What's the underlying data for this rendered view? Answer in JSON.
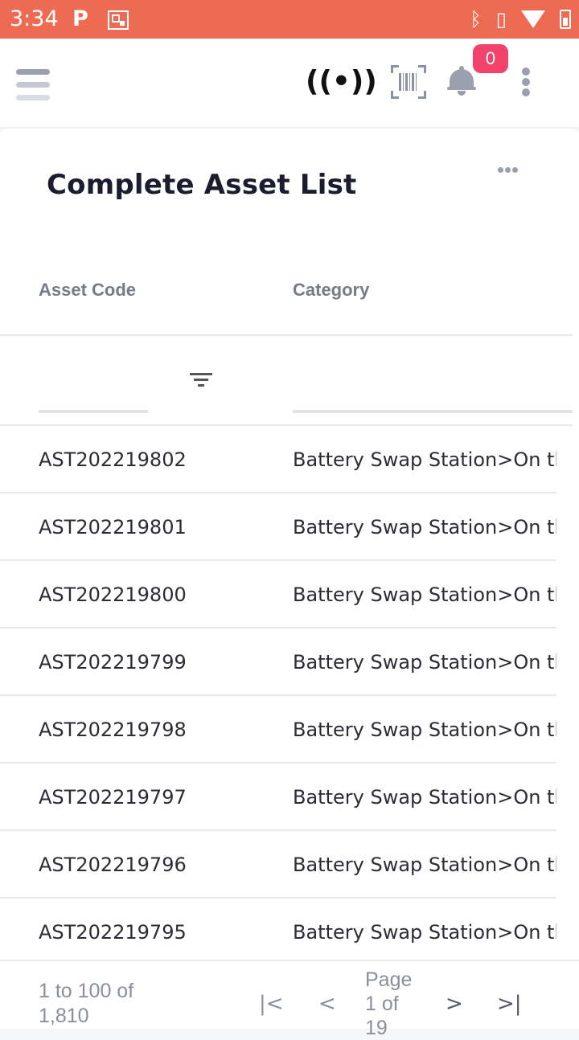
{
  "status_bar": {
    "time": "3:34",
    "notification_icons": [
      "p-icon",
      "qr-icon"
    ],
    "system_icons": [
      "bluetooth-icon",
      "vibrate-icon",
      "wifi-icon",
      "battery-icon"
    ]
  },
  "app_bar": {
    "icons": [
      "menu-icon",
      "rfid-icon",
      "barcode-scan-icon",
      "bell-icon",
      "more-vertical-icon"
    ],
    "rfid_glyph": "((•))",
    "notification_count": "0"
  },
  "card": {
    "title": "Complete Asset List"
  },
  "table": {
    "columns": [
      "Asset Code",
      "Category"
    ],
    "rows": [
      {
        "code": "AST202219802",
        "category": "Battery Swap Station>On the"
      },
      {
        "code": "AST202219801",
        "category": "Battery Swap Station>On the"
      },
      {
        "code": "AST202219800",
        "category": "Battery Swap Station>On the"
      },
      {
        "code": "AST202219799",
        "category": "Battery Swap Station>On the"
      },
      {
        "code": "AST202219798",
        "category": "Battery Swap Station>On the"
      },
      {
        "code": "AST202219797",
        "category": "Battery Swap Station>On the"
      },
      {
        "code": "AST202219796",
        "category": "Battery Swap Station>On the"
      },
      {
        "code": "AST202219795",
        "category": "Battery Swap Station>On the"
      }
    ]
  },
  "pagination": {
    "summary": "1 to 100 of 1,810",
    "page_info": "Page 1 of 19",
    "first_glyph": "|<",
    "prev_glyph": "<",
    "next_glyph": ">",
    "last_glyph": ">|"
  },
  "colors": {
    "status_bar": "#ee6b53",
    "badge": "#f0426b",
    "title": "#1b1d2e"
  }
}
